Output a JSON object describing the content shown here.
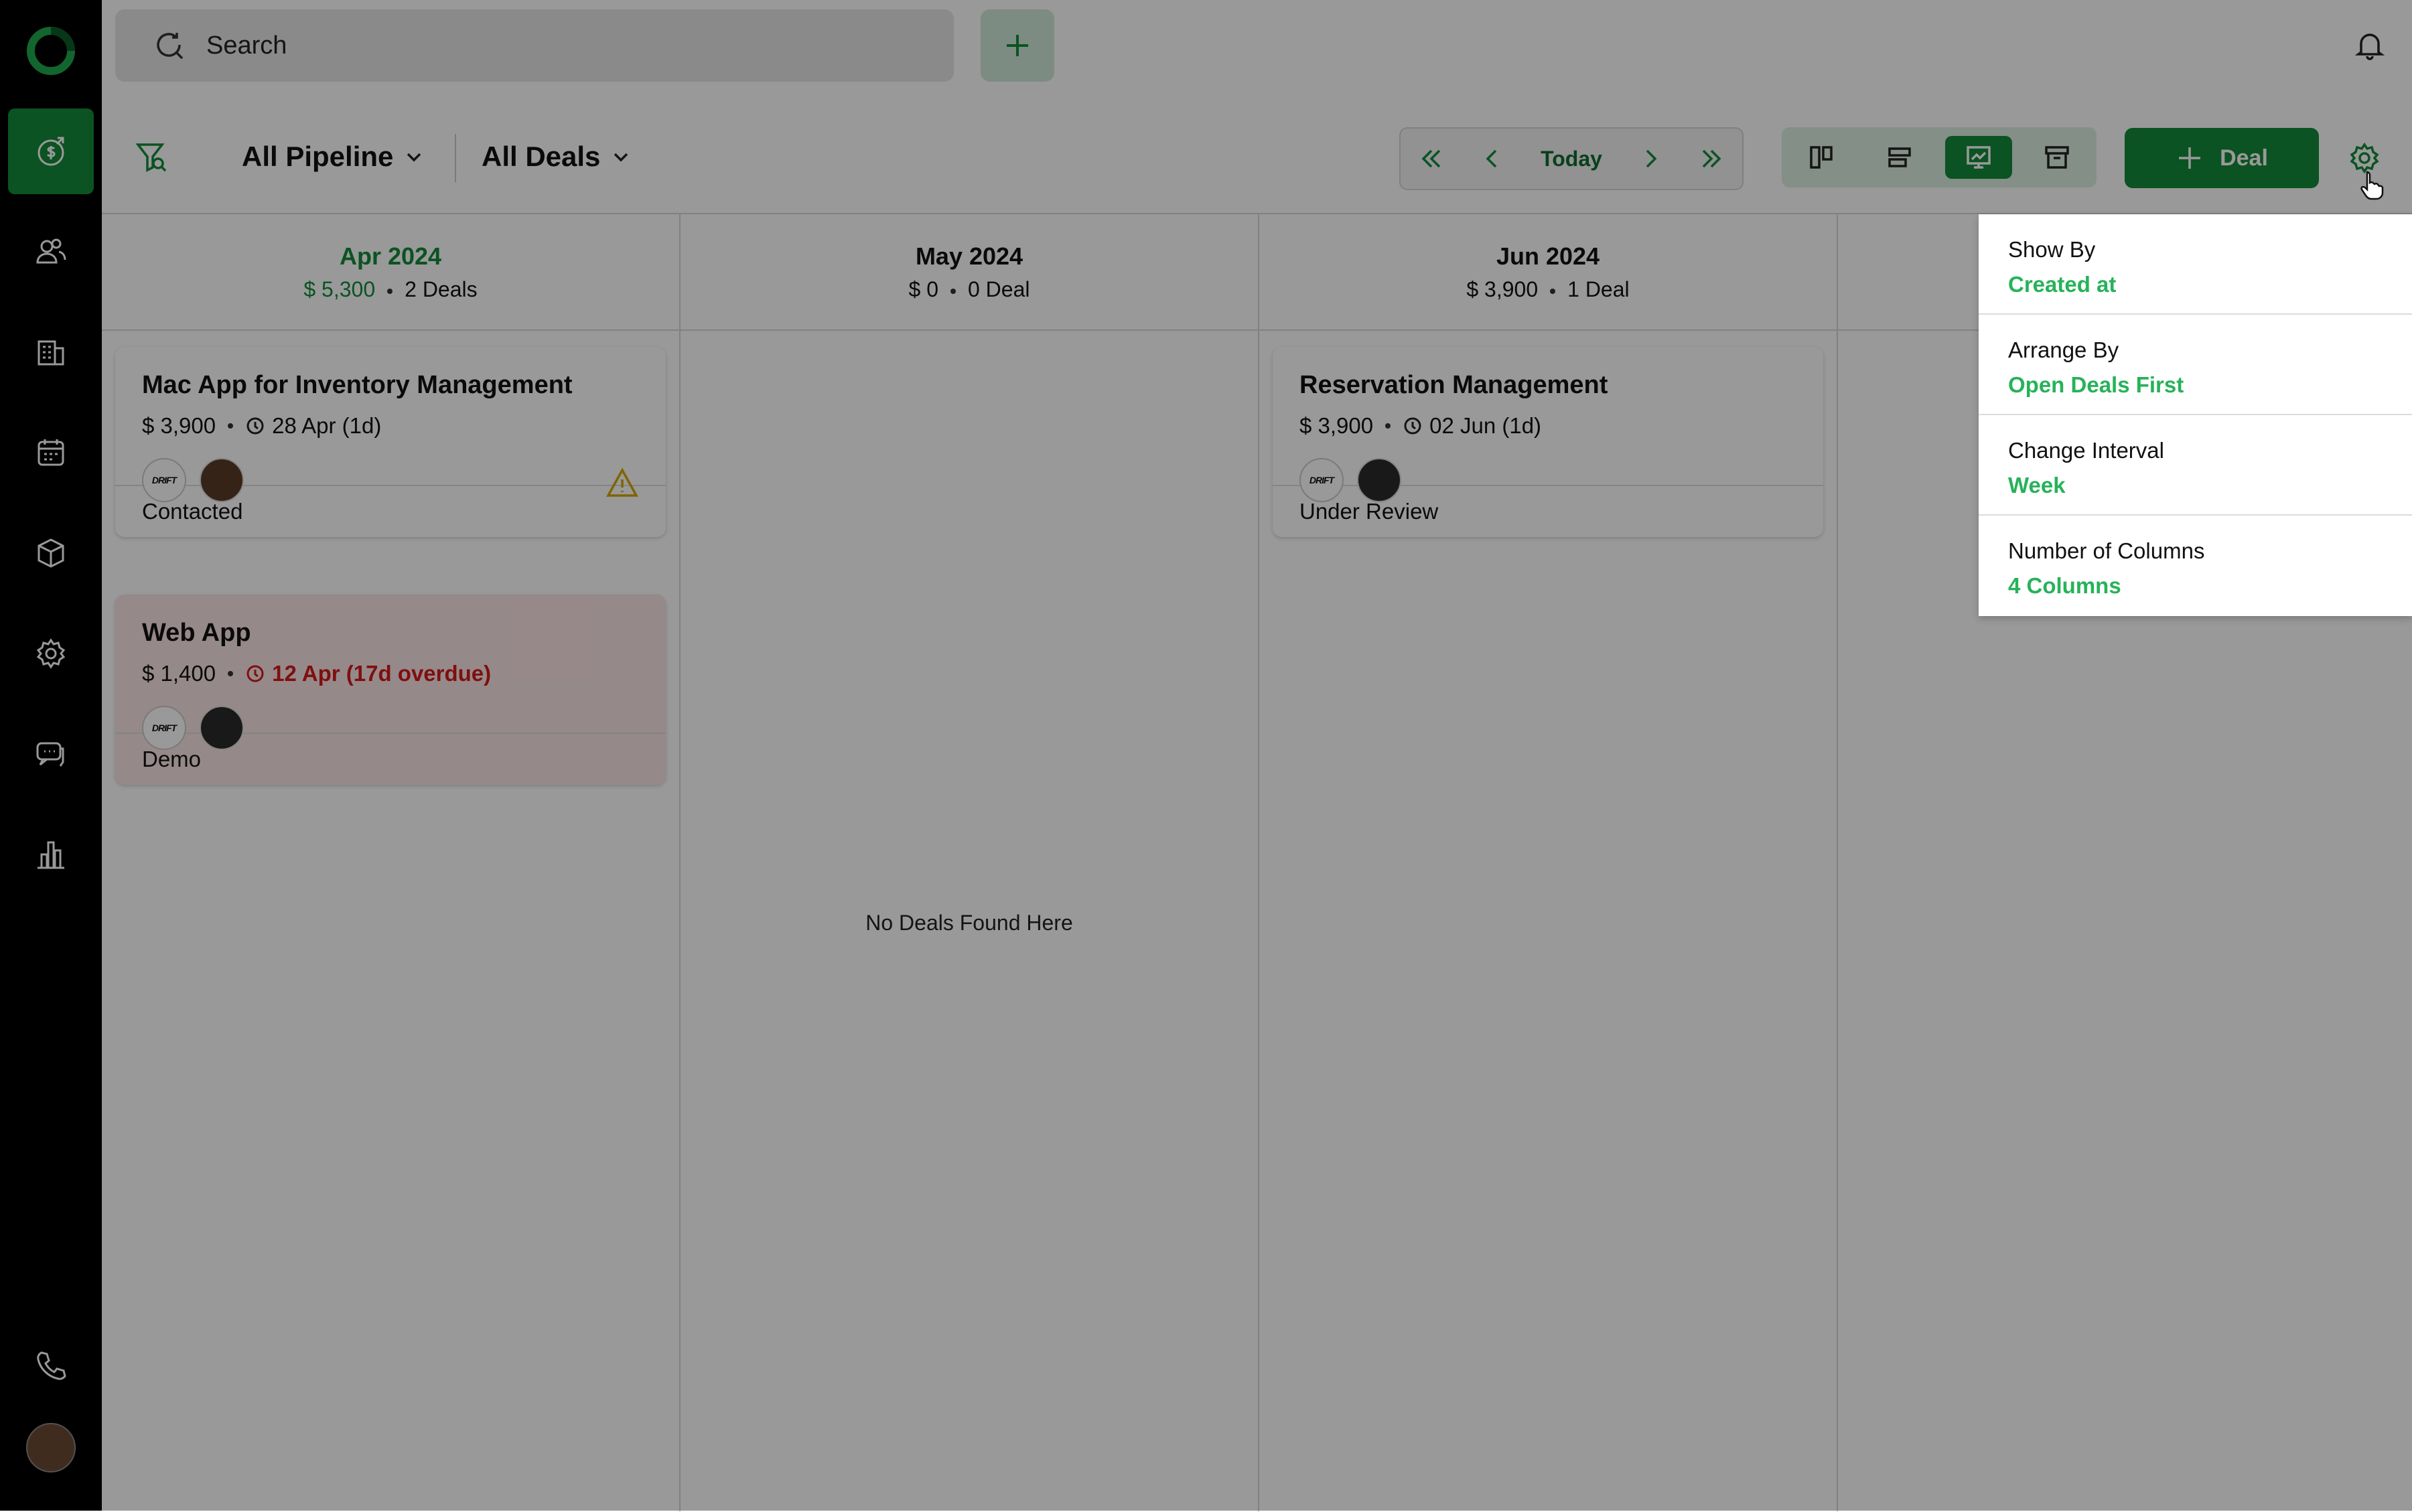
{
  "search": {
    "placeholder": "Search"
  },
  "toolbar": {
    "pipeline_label": "All Pipeline",
    "deals_label": "All Deals",
    "today_label": "Today",
    "add_deal_label": "Deal"
  },
  "columns": [
    {
      "title": "Apr 2024",
      "amount": "$ 5,300",
      "count": "2 Deals",
      "current": true
    },
    {
      "title": "May 2024",
      "amount": "$ 0",
      "count": "0 Deal",
      "empty_text": "No Deals Found Here"
    },
    {
      "title": "Jun 2024",
      "amount": "$ 3,900",
      "count": "1 Deal"
    }
  ],
  "cards": [
    {
      "title": "Mac App for Inventory Management",
      "amount": "$ 3,900",
      "due": "28 Apr (1d)",
      "company": "DRIFT",
      "stage": "Contacted",
      "warning": true
    },
    {
      "title": "Web App",
      "amount": "$ 1,400",
      "due": "12 Apr (17d overdue)",
      "company": "DRIFT",
      "stage": "Demo",
      "overdue": true
    },
    {
      "title": "Reservation Management",
      "amount": "$ 3,900",
      "due": "02 Jun (1d)",
      "company": "DRIFT",
      "stage": "Under Review"
    }
  ],
  "settings_menu": [
    {
      "label": "Show By",
      "value": "Created at"
    },
    {
      "label": "Arrange By",
      "value": "Open Deals First"
    },
    {
      "label": "Change Interval",
      "value": "Week"
    },
    {
      "label": "Number of Columns",
      "value": "4 Columns"
    }
  ],
  "colors": {
    "accent": "#138a3a",
    "menu_value": "#27b25a",
    "overdue": "#d41a1a"
  },
  "icons": {
    "sidebar": [
      "deals-icon",
      "contacts-icon",
      "companies-icon",
      "calendar-icon",
      "products-icon",
      "settings-icon",
      "chat-icon",
      "reports-icon",
      "phone-icon",
      "user-avatar"
    ]
  }
}
